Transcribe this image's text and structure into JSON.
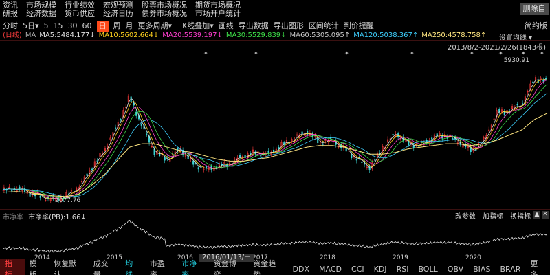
{
  "nav": {
    "row1": [
      "资讯",
      "市场规模",
      "行业绩效",
      "宏观预测",
      "股票市场概况",
      "期货市场概况"
    ],
    "row2": [
      "研报",
      "经济数据",
      "货币供应",
      "经济日历",
      "债券市场概况",
      "市场开户统计"
    ],
    "delete_label": "删除自"
  },
  "toolbar": {
    "items": [
      "分时",
      "5日▾",
      "5",
      "15",
      "30",
      "60",
      "日",
      "周",
      "月",
      "更多周期▾",
      "K线叠加▾",
      "画线",
      "导出数据",
      "导出图形",
      "区间统计",
      "到价提醒"
    ],
    "active": "日",
    "right_label": "简约版"
  },
  "ma": {
    "mode": "(日线)",
    "label": "MA",
    "items": [
      {
        "text": "MA5:5484.177↓",
        "color": "#e0e0e0"
      },
      {
        "text": "MA10:5602.664↓",
        "color": "#ffd21e"
      },
      {
        "text": "MA20:5539.197↓",
        "color": "#ff3fcf"
      },
      {
        "text": "MA30:5529.839↓",
        "color": "#3ee04a"
      },
      {
        "text": "MA60:5305.095↑",
        "color": "#c8c8c8"
      },
      {
        "text": "MA120:5038.367↑",
        "color": "#3ed0ff"
      },
      {
        "text": "MA250:4578.758↑",
        "color": "#ffe680"
      }
    ]
  },
  "chart_header": {
    "settings_label": "设置均线 ▾",
    "date_range": "2013/8/2-2021/2/26(1843根)",
    "max_label": "5930.91",
    "min_label": "2077.76"
  },
  "sub_chart": {
    "title_prefix": "市净率",
    "title": "市净率(PB):1.66↓",
    "buttons": [
      "改参数",
      "加指标",
      "换指标"
    ],
    "ctrl_up": "▲",
    "ctrl_close": "✕"
  },
  "x_axis": {
    "years": [
      "2014",
      "2015",
      "2016",
      "2017",
      "2018",
      "2019",
      "2020"
    ],
    "hover_date": "2016/01/13/三"
  },
  "bottom_tabs": {
    "items": [
      "指标",
      "模版",
      "恢复默认",
      "成交量",
      "均线",
      "市盈率",
      "市净率",
      "资金博弈",
      "资金趋势",
      "DDX",
      "MACD",
      "CCI",
      "KDJ",
      "RSI",
      "BOLL",
      "OBV",
      "BIAS",
      "BRAR",
      "更多"
    ],
    "indicator": "指标",
    "selected": [
      "均线",
      "市净率"
    ]
  },
  "chart_data": {
    "type": "line",
    "x_dates": [
      "2013-08",
      "2013-10",
      "2014-01",
      "2014-04",
      "2014-07",
      "2014-09",
      "2014-11",
      "2015-01",
      "2015-03",
      "2015-05",
      "2015-06",
      "2015-07",
      "2015-08",
      "2015-09",
      "2015-11",
      "2016-01",
      "2016-03",
      "2016-06",
      "2016-09",
      "2016-12",
      "2017-03",
      "2017-06",
      "2017-09",
      "2017-11",
      "2018-01",
      "2018-02",
      "2018-04",
      "2018-07",
      "2018-10",
      "2019-01",
      "2019-02",
      "2019-04",
      "2019-06",
      "2019-08",
      "2019-10",
      "2019-12",
      "2020-02",
      "2020-03",
      "2020-05",
      "2020-07",
      "2020-09",
      "2020-11",
      "2021-01",
      "2021-02"
    ],
    "close": [
      2350,
      2420,
      2300,
      2180,
      2080,
      2200,
      2450,
      3000,
      3500,
      4200,
      5050,
      4200,
      3450,
      3250,
      3550,
      3150,
      2950,
      3050,
      3150,
      3350,
      3450,
      3400,
      3650,
      3850,
      4050,
      3750,
      3800,
      3550,
      3250,
      3000,
      3600,
      4000,
      3700,
      3650,
      3900,
      3950,
      3750,
      3500,
      3800,
      4600,
      4650,
      4850,
      5600,
      5484
    ],
    "ma250_approx": [
      2300,
      2320,
      2300,
      2250,
      2200,
      2180,
      2250,
      2500,
      2800,
      3200,
      3600,
      3700,
      3700,
      3600,
      3500,
      3450,
      3350,
      3250,
      3200,
      3200,
      3250,
      3300,
      3400,
      3500,
      3600,
      3650,
      3650,
      3600,
      3500,
      3400,
      3400,
      3450,
      3550,
      3600,
      3650,
      3700,
      3700,
      3650,
      3700,
      3800,
      3950,
      4100,
      4400,
      4578
    ],
    "pb_subchart": "PB ratio line, peaks mid-2015, latest 1.66",
    "ylim": [
      1900,
      6100
    ]
  }
}
